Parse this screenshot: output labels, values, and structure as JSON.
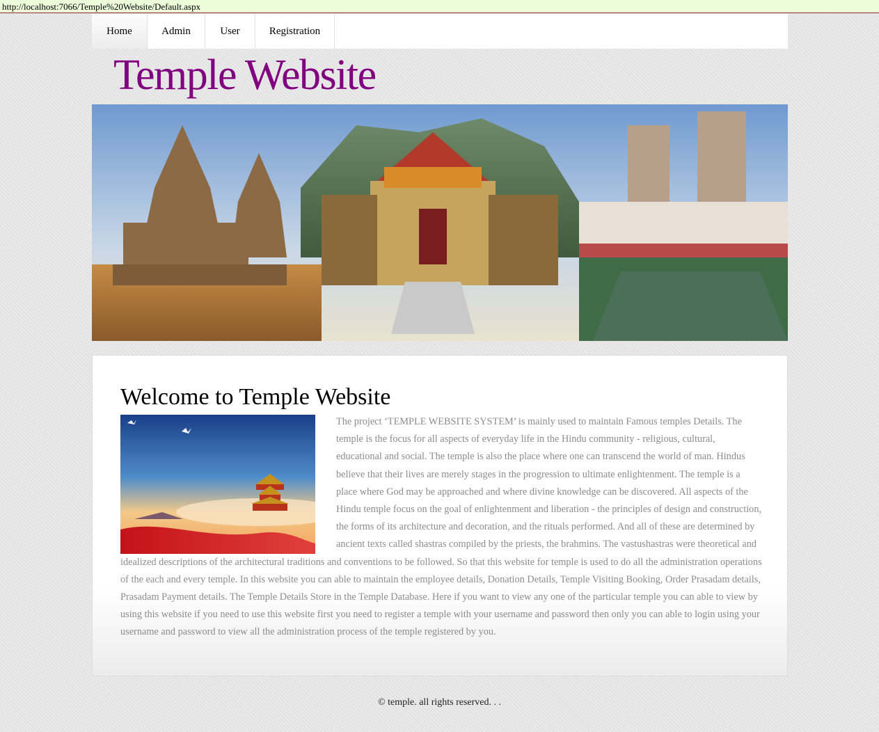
{
  "browser": {
    "url": "http://localhost:7066/Temple%20Website/Default.aspx"
  },
  "nav": {
    "items": [
      {
        "label": "Home"
      },
      {
        "label": "Admin"
      },
      {
        "label": "User"
      },
      {
        "label": "Registration"
      }
    ]
  },
  "header": {
    "title": "Temple Website"
  },
  "main": {
    "heading": "Welcome to Temple Website",
    "paragraph": "The project ‘TEMPLE WEBSITE SYSTEM’ is mainly used to maintain Famous temples Details. The temple is the focus for all aspects of everyday life in the Hindu community - religious, cultural, educational and social. The temple is also the place where one can transcend the world of man. Hindus believe that their lives are merely stages in the progression to ultimate enlightenment. The temple is a place where God may be approached and where divine knowledge can be discovered. All aspects of the Hindu temple focus on the goal of enlightenment and liberation - the principles of design and construction, the forms of its architecture and decoration, and the rituals performed. And all of these are determined by ancient texts called shastras compiled by the priests, the brahmins. The vastushastras were theoretical and idealized descriptions of the architectural traditions and conventions to be followed. So that this website for temple is used to do all the administration operations of the each and every temple. In this website you can able to maintain the employee details, Donation Details, Temple Visiting Booking, Order Prasadam details, Prasadam Payment details. The Temple Details Store in the Temple Database. Here if you want to view any one of the particular temple you can able to view by using this website if you need to use this website first you need to register a temple with your username and password then only you can able to login using your username and password to view all the administration process of the temple registered by you."
  },
  "footer": {
    "text": "© temple. all rights reserved. . ."
  },
  "colors": {
    "title": "#800080",
    "body_text": "#8c8c8c",
    "url_bar": "#ecfbd9"
  }
}
